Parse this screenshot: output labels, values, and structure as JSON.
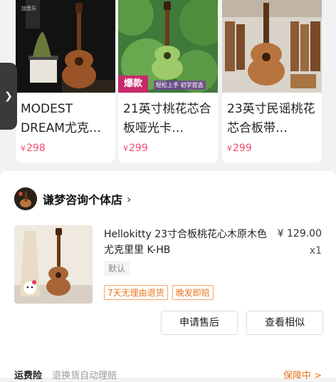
{
  "carousel": {
    "products": [
      {
        "title": "MODEST DREAM尤克…",
        "price_currency": "¥",
        "price_value": "298"
      },
      {
        "title": "21英寸桃花芯合板哑光卡…",
        "price_currency": "¥",
        "price_value": "299",
        "badge": "爆款",
        "badge_sub": "轻松上手 初学首选"
      },
      {
        "title": "23英寸民谣桃花芯合板带…",
        "price_currency": "¥",
        "price_value": "299"
      }
    ]
  },
  "order": {
    "store_name": "谦梦咨询个体店",
    "item_title": "Hellokitty 23寸合板桃花心木原木色尤克里里 K-HB",
    "price": "¥ 129.00",
    "quantity": "x1",
    "sku": "默认",
    "service_tags": [
      "7天无理由退货",
      "晚发即赔"
    ],
    "buttons": {
      "after_sale": "申请售后",
      "similar": "查看相似"
    },
    "shipping": {
      "label": "运费险",
      "desc": "退换货自动理赔",
      "status": "保障中 >"
    }
  },
  "colors": {
    "price_red": "#f0506e",
    "accent_orange": "#e8731c",
    "badge_pink": "#c72a6b"
  }
}
